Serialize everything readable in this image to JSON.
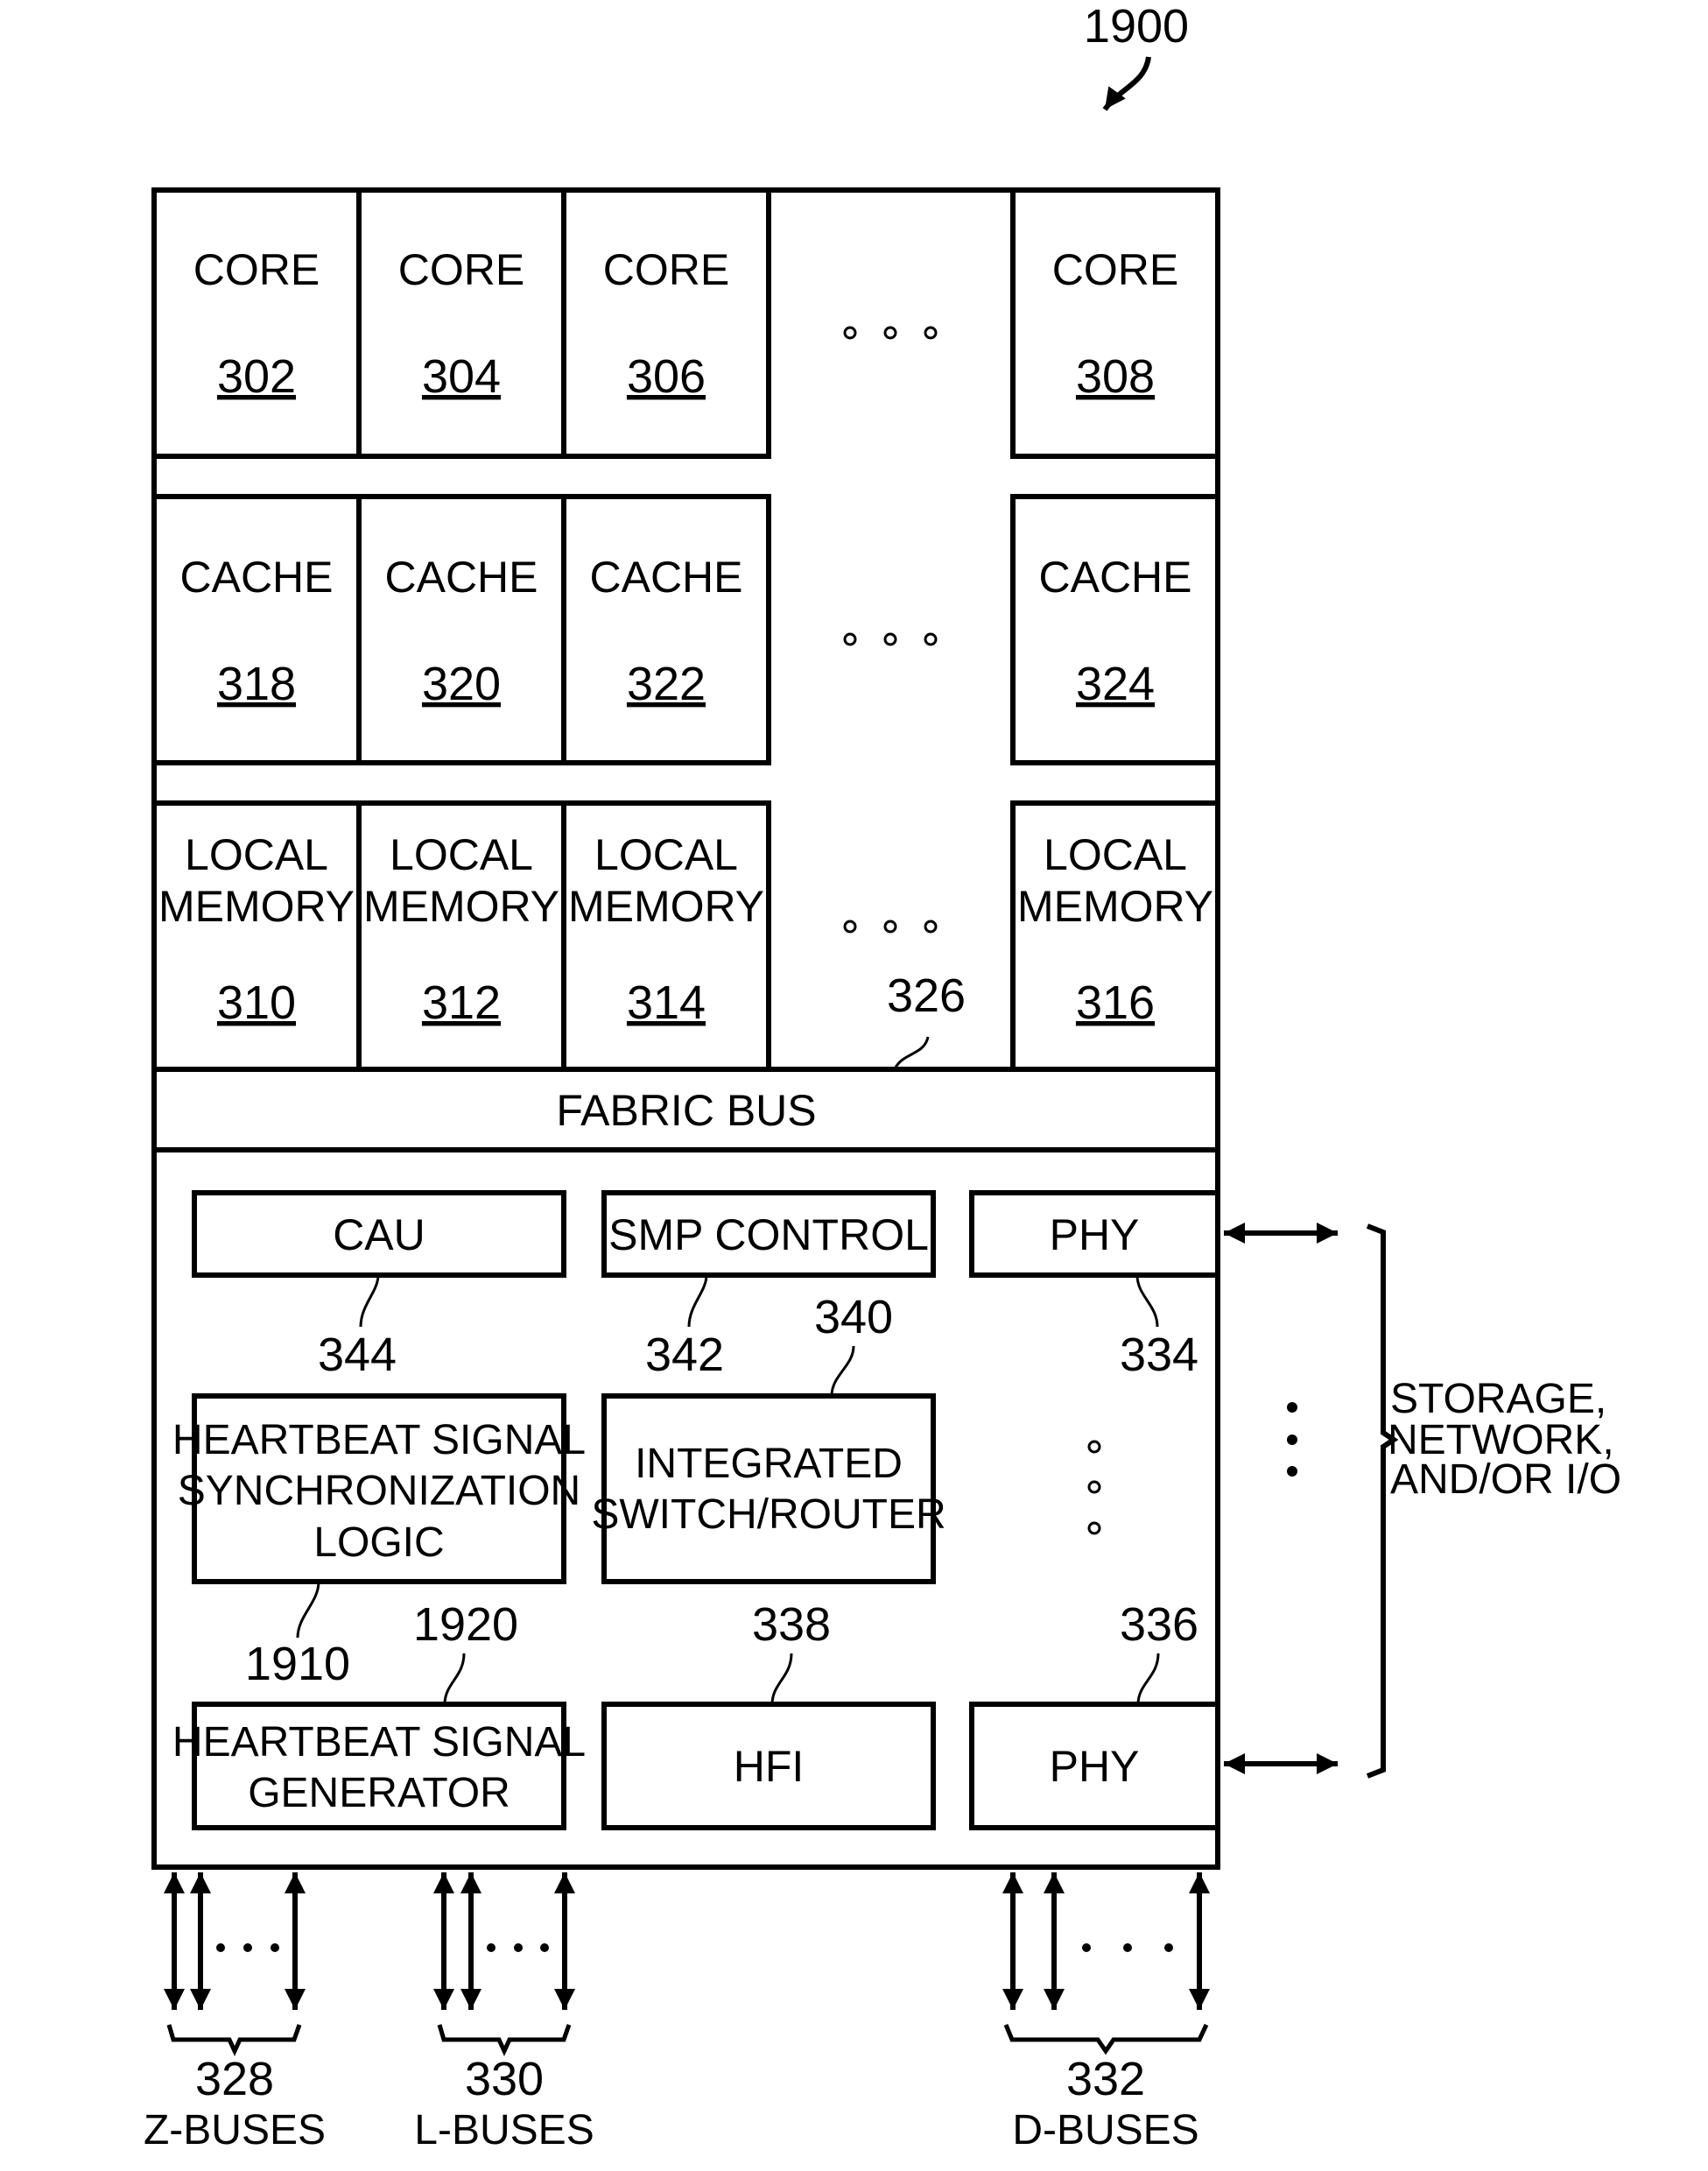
{
  "figure": {
    "ref": "1900",
    "cores": [
      {
        "label": "CORE",
        "ref": "302"
      },
      {
        "label": "CORE",
        "ref": "304"
      },
      {
        "label": "CORE",
        "ref": "306"
      },
      {
        "label": "CORE",
        "ref": "308"
      }
    ],
    "caches": [
      {
        "label": "CACHE",
        "ref": "318"
      },
      {
        "label": "CACHE",
        "ref": "320"
      },
      {
        "label": "CACHE",
        "ref": "322"
      },
      {
        "label": "CACHE",
        "ref": "324"
      }
    ],
    "memories": [
      {
        "line1": "LOCAL",
        "line2": "MEMORY",
        "ref": "310"
      },
      {
        "line1": "LOCAL",
        "line2": "MEMORY",
        "ref": "312"
      },
      {
        "line1": "LOCAL",
        "line2": "MEMORY",
        "ref": "314"
      },
      {
        "line1": "LOCAL",
        "line2": "MEMORY",
        "ref": "316"
      }
    ],
    "fabric_bus": {
      "label": "FABRIC BUS",
      "ref": "326"
    },
    "components": {
      "cau": {
        "label": "CAU",
        "ref": "344"
      },
      "smp": {
        "label": "SMP CONTROL",
        "ref": "342"
      },
      "phy_top": {
        "label": "PHY",
        "ref": "334"
      },
      "hb_sync": {
        "line1": "HEARTBEAT SIGNAL",
        "line2": "SYNCHRONIZATION",
        "line3": "LOGIC",
        "ref": "1910"
      },
      "switch": {
        "line1": "INTEGRATED",
        "line2": "SWITCH/ROUTER",
        "ref": "340"
      },
      "hb_gen": {
        "line1": "HEARTBEAT SIGNAL",
        "line2": "GENERATOR",
        "ref": "1920"
      },
      "hfi": {
        "label": "HFI",
        "ref": "338"
      },
      "phy_bottom": {
        "label": "PHY",
        "ref": "336"
      }
    },
    "external": {
      "line1": "STORAGE,",
      "line2": "NETWORK,",
      "line3": "AND/OR I/O"
    },
    "buses": [
      {
        "ref": "328",
        "label": "Z-BUSES"
      },
      {
        "ref": "330",
        "label": "L-BUSES"
      },
      {
        "ref": "332",
        "label": "D-BUSES"
      }
    ]
  }
}
